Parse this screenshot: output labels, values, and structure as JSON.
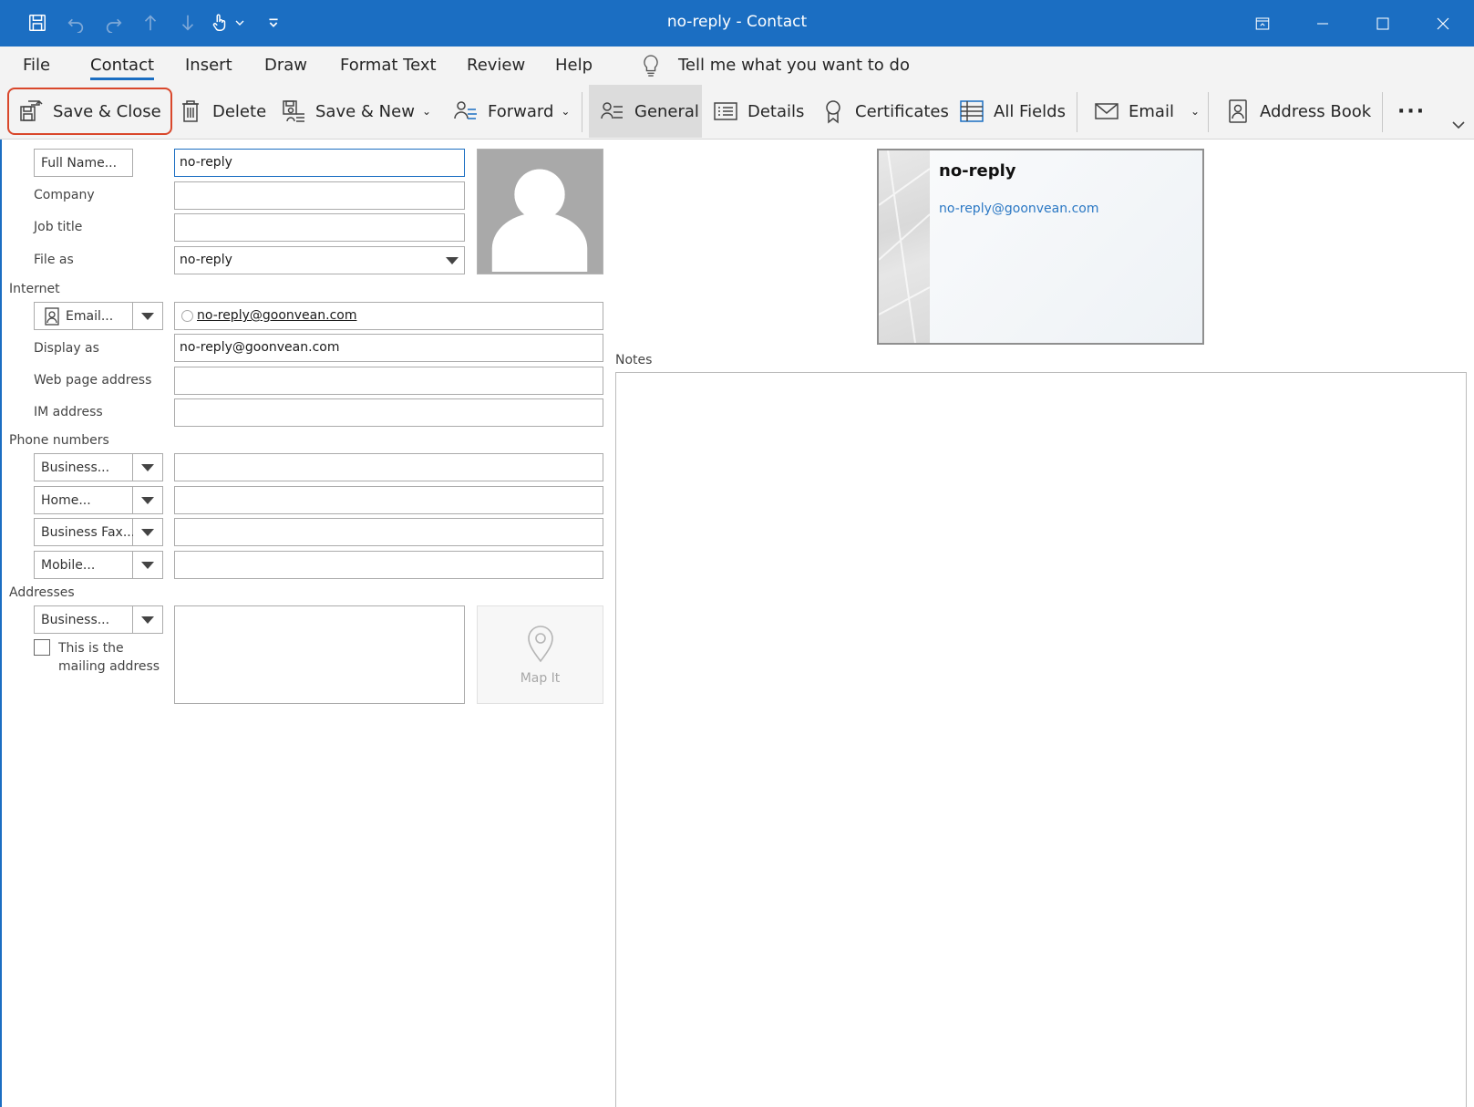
{
  "window": {
    "title": "no-reply  -  Contact",
    "accent_color": "#1b6ec2"
  },
  "quick_access": [
    "save-icon",
    "undo-icon",
    "redo-icon",
    "up-icon",
    "down-icon",
    "touch-mode-icon",
    "customize-icon"
  ],
  "menu_tabs": [
    "File",
    "Contact",
    "Insert",
    "Draw",
    "Format Text",
    "Review",
    "Help"
  ],
  "active_tab": "Contact",
  "tell_me": "Tell me what you want to do",
  "ribbon": {
    "save_close": "Save & Close",
    "delete": "Delete",
    "save_new": "Save & New",
    "forward": "Forward",
    "general": "General",
    "details": "Details",
    "certificates": "Certificates",
    "all_fields": "All Fields",
    "email": "Email",
    "address_book": "Address Book",
    "more": "···"
  },
  "form": {
    "full_name_button": "Full Name...",
    "full_name_value": "no-reply",
    "company_label": "Company",
    "company_value": "",
    "job_title_label": "Job title",
    "job_title_value": "",
    "file_as_label": "File as",
    "file_as_value": "no-reply",
    "internet_section": "Internet",
    "email_button": "Email...",
    "email_value": "no-reply@goonvean.com",
    "display_as_label": "Display as",
    "display_as_value": "no-reply@goonvean.com",
    "web_page_label": "Web page address",
    "web_page_value": "",
    "im_label": "IM address",
    "im_value": "",
    "phone_section": "Phone numbers",
    "phone_business": "Business...",
    "phone_home": "Home...",
    "phone_business_fax": "Business Fax...",
    "phone_mobile": "Mobile...",
    "addresses_section": "Addresses",
    "address_type": "Business...",
    "address_value": "",
    "mailing_address_label": "This is the mailing address",
    "mailing_address_checked": false,
    "map_it": "Map It"
  },
  "business_card": {
    "name": "no-reply",
    "email": "no-reply@goonvean.com"
  },
  "notes": {
    "label": "Notes",
    "value": ""
  }
}
